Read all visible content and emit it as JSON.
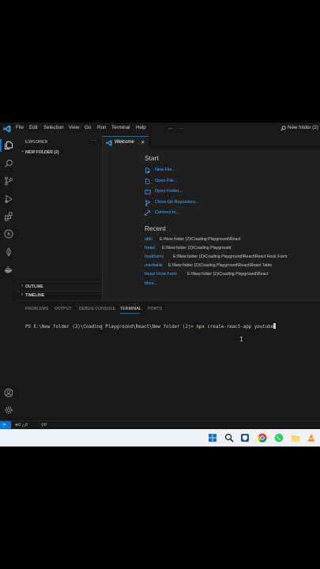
{
  "menu": [
    "File",
    "Edit",
    "Selection",
    "View",
    "Go",
    "Run",
    "Terminal",
    "Help"
  ],
  "search": {
    "text": "New folder (2)"
  },
  "explorer": {
    "header": "EXPLORER",
    "more": "···",
    "folder": "NEW FOLDER (2)",
    "outline": "OUTLINE",
    "timeline": "TIMELINE"
  },
  "tab": {
    "label": "Welcome",
    "close": "✕"
  },
  "welcome": {
    "start_title": "Start",
    "start_items": [
      "New File...",
      "Open File...",
      "Open Folder...",
      "Clone Git Repository...",
      "Connect to..."
    ],
    "recent_title": "Recent",
    "recent": [
      {
        "name": "abhi",
        "path": "E:\\New folder (2)\\Coading Playground\\React"
      },
      {
        "name": "React",
        "path": "E:\\New folder (2)\\Coading Playground"
      },
      {
        "name": "hookforms",
        "path": "E:\\New folder (2)\\Coading Playground\\React\\React Hook Form"
      },
      {
        "name": "reacttable",
        "path": "E:\\New folder (2)\\Coading Playground\\React\\React Table"
      },
      {
        "name": "React Hook Form",
        "path": "E:\\New folder (2)\\Coading Playground\\React"
      }
    ],
    "more": "More..."
  },
  "panel": {
    "tabs": [
      "PROBLEMS",
      "OUTPUT",
      "DEBUG CONSOLE",
      "TERMINAL",
      "PORTS"
    ],
    "active_tab": "TERMINAL",
    "prompt": "PS E:\\New folder (2)\\Coading Playground\\React\\New folder (2)>",
    "command": "npx",
    "args": "create-react-app youtube"
  },
  "status": {
    "errors": "0",
    "warnings": "0",
    "ports": "0"
  },
  "colors": {
    "accent": "#0078d4",
    "link": "#4daafc",
    "command": "#dcdcaa"
  }
}
